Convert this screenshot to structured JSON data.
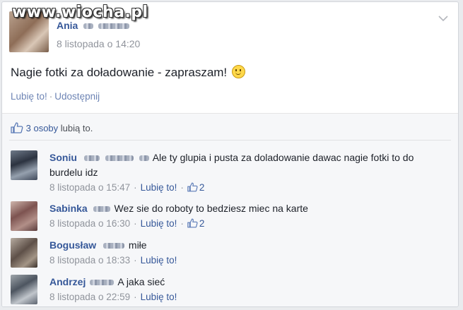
{
  "watermark": "www.wiocha.pl",
  "post": {
    "author_name": "Ania",
    "timestamp": "8 listopada o 14:20",
    "text": "Nagie fotki za doładowanie - zapraszam!",
    "emoji": "smiley-emoji",
    "actions": {
      "like": "Lubię to!",
      "separator": "·",
      "share": "Udostępnij"
    }
  },
  "likes_summary": {
    "count_text": "3 osoby",
    "suffix": "lubią to.",
    "icon": "thumbs-up-icon"
  },
  "comments": [
    {
      "author": "Soniu",
      "text": "Ale ty glupia i pusta za doladowanie dawac nagie fotki to do burdelu idz",
      "timestamp": "8 listopada o 15:47",
      "like_label": "Lubię to!",
      "like_count": "2"
    },
    {
      "author": "Sabinka",
      "text": "Wez sie do roboty to bedziesz miec na karte",
      "timestamp": "8 listopada o 16:30",
      "like_label": "Lubię to!",
      "like_count": "2"
    },
    {
      "author": "Bogusław",
      "text": "miłe",
      "timestamp": "8 listopada o 18:33",
      "like_label": "Lubię to!"
    },
    {
      "author": "Andrzej",
      "text": "A jaka sieć",
      "timestamp": "8 listopada o 22:59",
      "like_label": "Lubię to!"
    }
  ],
  "colors": {
    "link": "#365899",
    "muted": "#90949c",
    "background": "#f6f7f9"
  }
}
